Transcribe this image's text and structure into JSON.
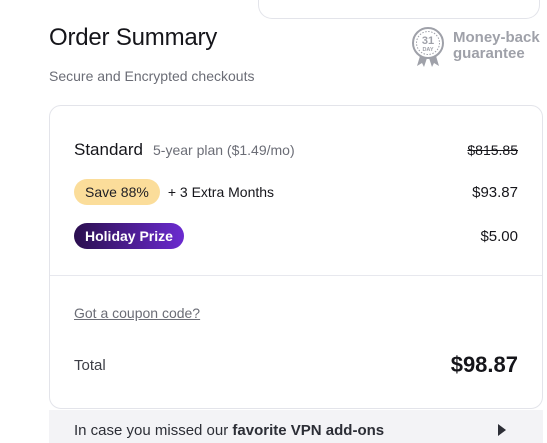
{
  "header": {
    "title": "Order Summary",
    "subtitle": "Secure and Encrypted checkouts"
  },
  "guarantee": {
    "badge_number": "31",
    "badge_unit": "DAY",
    "line1": "Money-back",
    "line2": "guarantee",
    "icon": "ribbon-badge-icon"
  },
  "order": {
    "plan_name": "Standard",
    "plan_desc": "5-year plan ($1.49/mo)",
    "original_price": "$815.85",
    "save_badge": "Save 88%",
    "extra_prefix": "+ 3",
    "extra_suffix": "Extra Months",
    "discounted_price": "$93.87",
    "prize_badge": "Holiday Prize",
    "prize_price": "$5.00",
    "coupon_link": "Got a coupon code?",
    "total_label": "Total",
    "total_amount": "$98.87"
  },
  "addons": {
    "text_prefix": "In case you missed our ",
    "text_strong": "favorite VPN add-ons",
    "icon": "chevron-right-icon"
  },
  "colors": {
    "save_badge_bg": "#fbdd9a",
    "prize_gradient_start": "#2b0f4f",
    "prize_gradient_end": "#6b2bd0",
    "muted_text": "#6b6d76"
  }
}
